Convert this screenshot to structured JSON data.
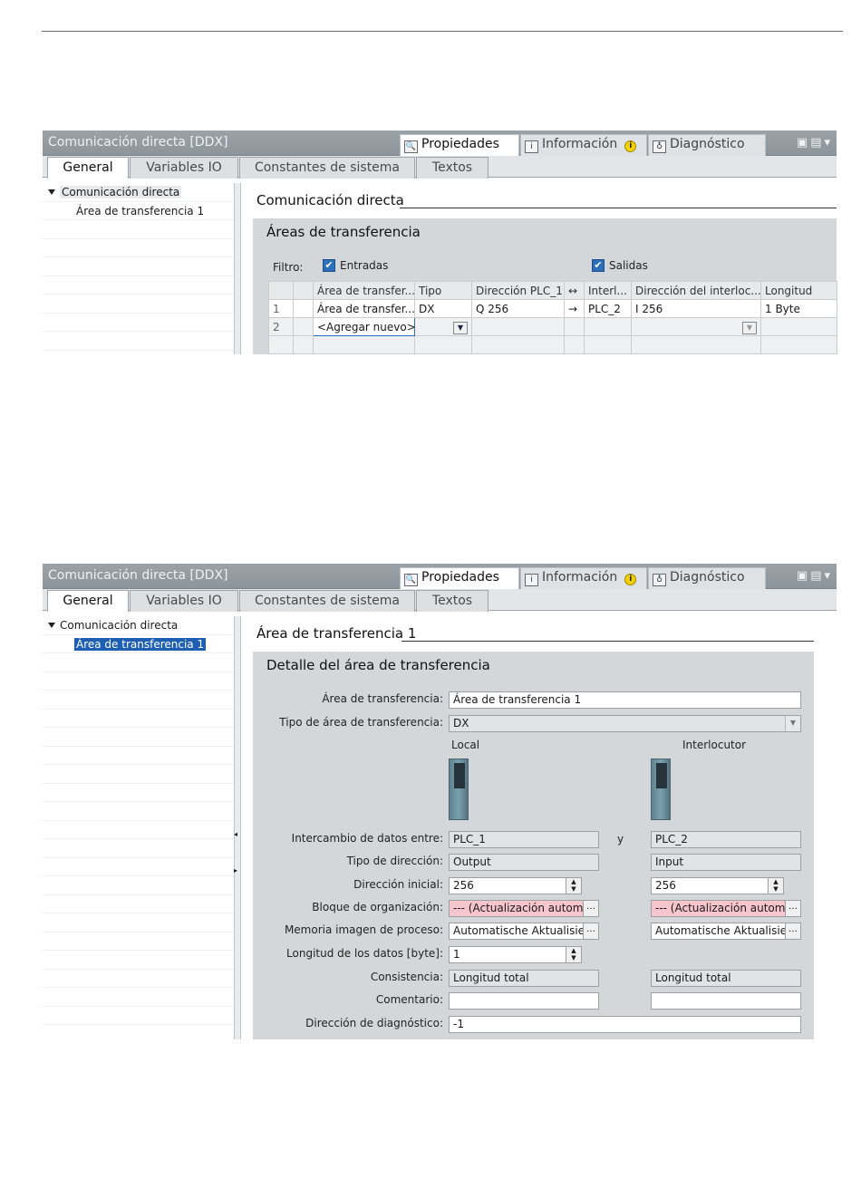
{
  "window_title": "Comunicación directa [DDX]",
  "panel_tabs": {
    "properties": "Propiedades",
    "info": "Información",
    "diagnostics": "Diagnóstico"
  },
  "sub_tabs": [
    "General",
    "Variables IO",
    "Constantes de sistema",
    "Textos"
  ],
  "nav": {
    "root": "Comunicación directa",
    "child": "Área de transferencia 1"
  },
  "screen1": {
    "section_title": "Comunicación directa",
    "group_title": "Áreas de transferencia",
    "filter_label": "Filtro:",
    "filter_inputs": "Entradas",
    "filter_outputs": "Salidas",
    "columns": [
      "Área de transfer...",
      "Tipo",
      "Dirección PLC_1",
      "↔",
      "Interl...",
      "Dirección del interloc...",
      "Longitud"
    ],
    "rows": [
      {
        "num": "1",
        "name": "Área de transfer...",
        "type": "DX",
        "addr1": "Q 256",
        "arrow": "→",
        "partner": "PLC_2",
        "addr2": "I 256",
        "length": "1 Byte"
      },
      {
        "num": "2",
        "name": "<Agregar nuevo>"
      }
    ]
  },
  "screen2": {
    "section_title": "Área de transferencia 1",
    "group_title": "Detalle del área de transferencia",
    "labels": {
      "area": "Área de transferencia:",
      "type": "Tipo de área de transferencia:",
      "exchange": "Intercambio de datos entre:",
      "addr_type": "Tipo de dirección:",
      "start_addr": "Dirección inicial:",
      "ob": "Bloque de organización:",
      "pip": "Memoria imagen de proceso:",
      "length": "Longitud de los datos [byte]:",
      "consistency": "Consistencia:",
      "comment": "Comentario:",
      "diag": "Dirección de diagnóstico:"
    },
    "local_label": "Local",
    "partner_label": "Interlocutor",
    "y_label": "y",
    "values": {
      "area": "Área de transferencia 1",
      "type": "DX",
      "plc_local": "PLC_1",
      "plc_partner": "PLC_2",
      "addr_type_local": "Output",
      "addr_type_partner": "Input",
      "start_local": "256",
      "start_partner": "256",
      "ob_local": "--- (Actualización automá",
      "ob_partner": "--- (Actualización automá",
      "pip_local": "Automatische Aktualisieru",
      "pip_partner": "Automatische Aktualisieru",
      "length": "1",
      "cons_local": "Longitud total",
      "cons_partner": "Longitud total",
      "comment_local": "",
      "comment_partner": "",
      "diag": "-1"
    }
  }
}
